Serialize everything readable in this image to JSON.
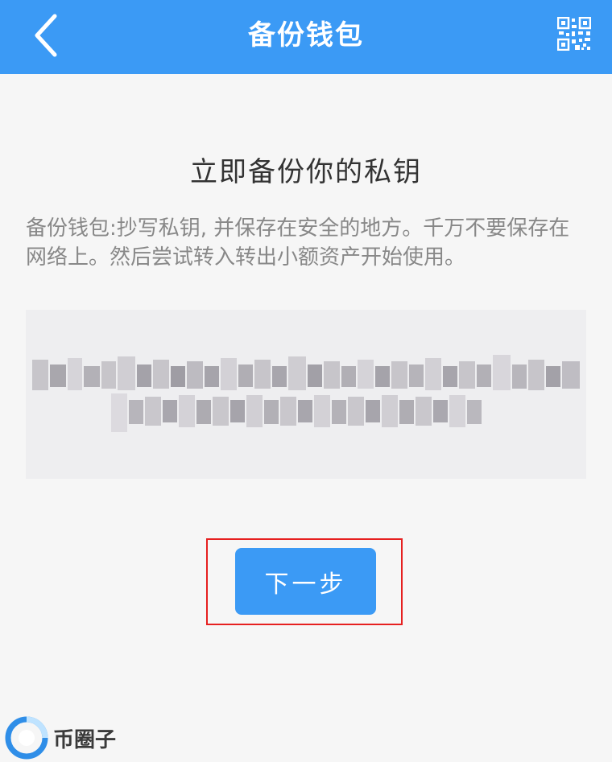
{
  "header": {
    "title": "备份钱包",
    "back_icon": "chevron-left-icon",
    "qr_icon": "qr-code-icon",
    "background": "#3b9af5"
  },
  "main": {
    "heading": "立即备份你的私钥",
    "description": "备份钱包:抄写私钥, 并保存在安全的地方。千万不要保存在网络上。然后尝试转入转出小额资产开始使用。",
    "private_key": ""
  },
  "actions": {
    "next_label": "下一步",
    "accent": "#3b9af5",
    "highlight_color": "#e62020"
  },
  "watermark": {
    "text": "币圈子"
  }
}
